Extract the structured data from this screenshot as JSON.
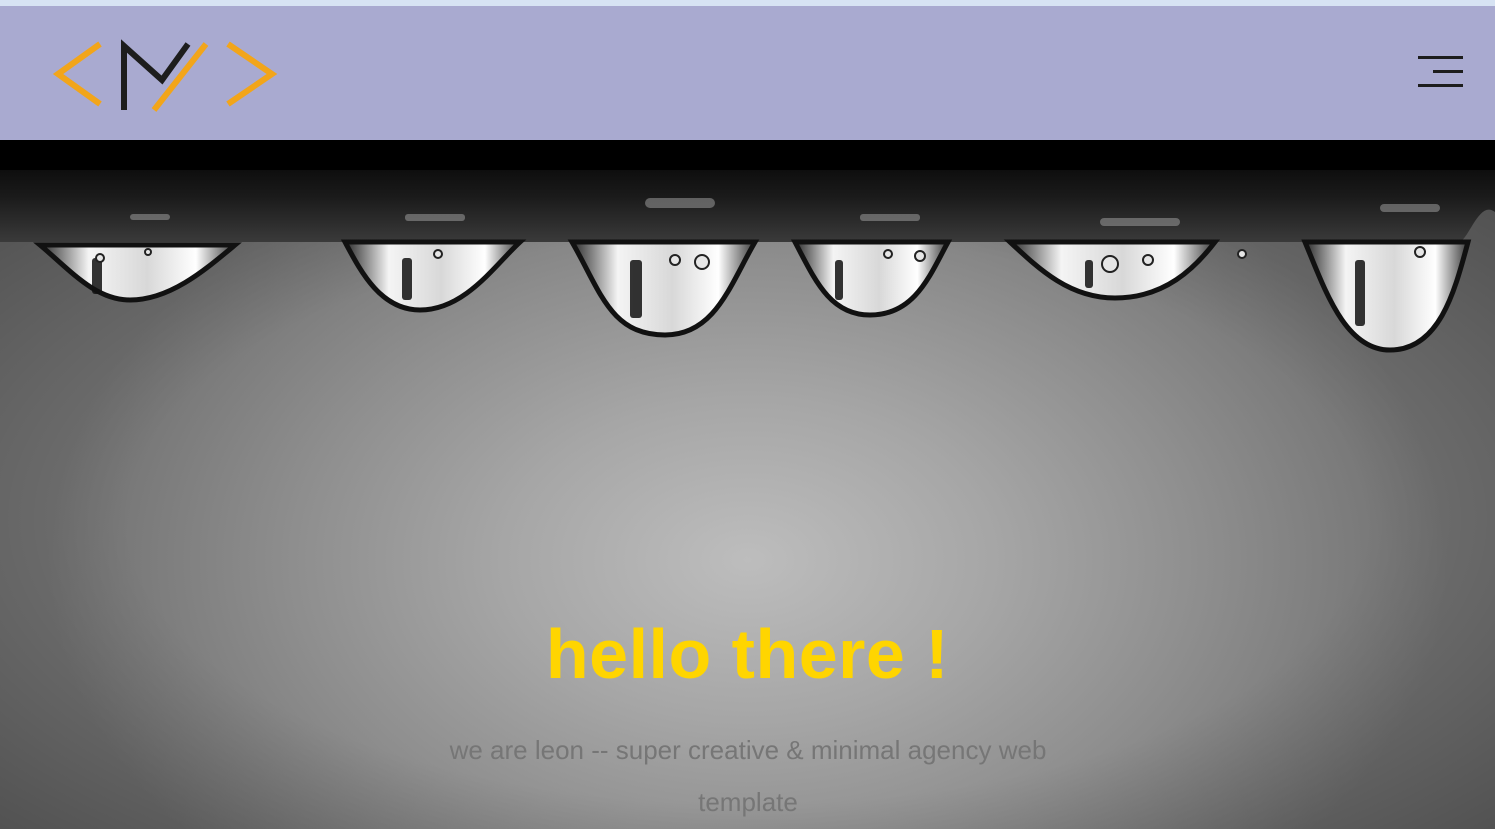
{
  "header": {
    "logo_icon": "code-m-logo-icon",
    "menu_icon": "hamburger-menu-icon",
    "background_color": "#a9aad0"
  },
  "hero": {
    "background_icon": "water-droplets-photo",
    "title": "hello there !",
    "subtitle": "we are leon -- super creative & minimal agency web template",
    "title_color": "#ffd500",
    "subtitle_color": "#767676"
  }
}
